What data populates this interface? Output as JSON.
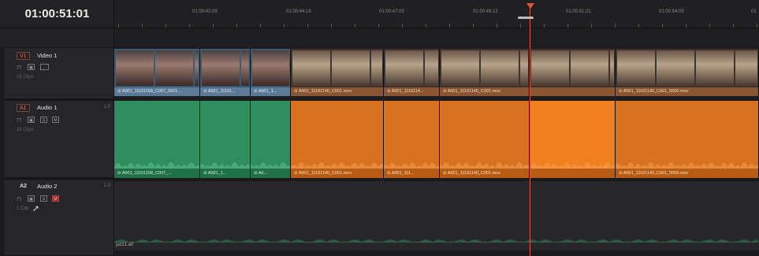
{
  "timecode": "01:00:51:01",
  "ruler": {
    "labels": [
      "01:00:42:09",
      "01:00:44:18",
      "01:00:47:03",
      "01:00:49:12",
      "01:00:51:21",
      "01:00:54:05",
      "01"
    ]
  },
  "tracks": {
    "v1": {
      "id": "V1",
      "name": "Video 1",
      "clips": "18 Clips"
    },
    "a1": {
      "id": "A1",
      "name": "Audio 1",
      "num": "1.0",
      "clips": "16 Clips",
      "btn_s": "S",
      "btn_m": "M"
    },
    "a2": {
      "id": "A2",
      "name": "Audio 2",
      "num": "2.0",
      "clips": "1 Clip",
      "btn_s": "S",
      "btn_m": "M"
    }
  },
  "video_clips": [
    {
      "label": "A001_11161158_C007_5001...",
      "style": "blue"
    },
    {
      "label": "A001_11161...",
      "style": "blue"
    },
    {
      "label": "A001_1...",
      "style": "blue"
    },
    {
      "label": "A001_11161140_C001.mov",
      "style": "orange"
    },
    {
      "label": "A001_1116114...",
      "style": "orange"
    },
    {
      "label": "A001_11161140_C001.mov",
      "style": "orange"
    },
    {
      "label": "",
      "style": "orange"
    },
    {
      "label": "A001_11161140_C001_5000.mov",
      "style": "orange"
    }
  ],
  "audio_clips": [
    {
      "label": "A001_11161158_C007_...",
      "style": "green"
    },
    {
      "label": "A001_1...",
      "style": "green"
    },
    {
      "label": "A0...",
      "style": "green"
    },
    {
      "label": "A001_11161140_C001.mov",
      "style": "orange"
    },
    {
      "label": "A001_111...",
      "style": "orange"
    },
    {
      "label": "A001_11161140_C001.mov",
      "style": "orange"
    },
    {
      "label": "",
      "style": "orange"
    },
    {
      "label": "A001_11161140_C001_5000.mov",
      "style": "orange"
    }
  ],
  "a2_clip_label": "jazz1.aif",
  "colors": {
    "playhead": "#e5533d",
    "video_clip_blue": "#5a7a97",
    "audio_green": "#2f8d60",
    "audio_orange": "#d97220",
    "mute_active": "#8a2c2c"
  }
}
